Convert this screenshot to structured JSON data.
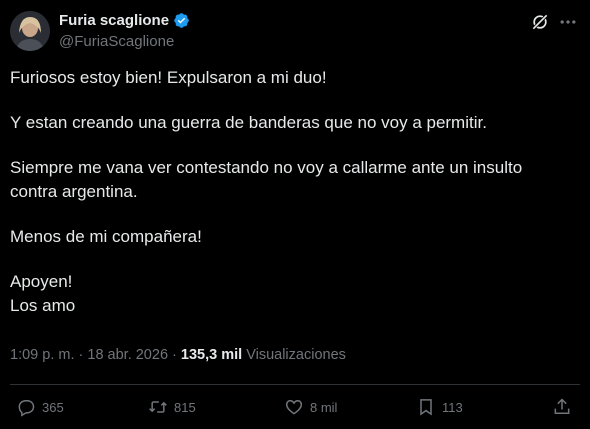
{
  "author": {
    "name": "Furia scaglione",
    "handle": "@FuriaScaglione",
    "verified": true
  },
  "tweet": {
    "lines": [
      "Furiosos estoy bien! Expulsaron a mi duo!",
      "Y estan creando una guerra de banderas que no voy a permitir.",
      "Siempre me vana ver contestando no voy a callarme ante un insulto contra argentina.",
      "Menos de mi compañera!",
      "Apoyen!",
      "Los amo"
    ]
  },
  "meta": {
    "time": "1:09 p. m.",
    "date": "18 abr. 2026",
    "views_count": "135,3 mil",
    "views_label": "Visualizaciones"
  },
  "actions": {
    "replies": "365",
    "retweets": "815",
    "likes": "8 mil",
    "bookmarks": "113"
  },
  "colors": {
    "background": "#000000",
    "text": "#e7e9ea",
    "muted": "#71767b",
    "verified": "#1d9bf0",
    "divider": "#2f3336"
  },
  "icons": [
    "verified-badge-icon",
    "grok-icon",
    "more-icon",
    "reply-icon",
    "retweet-icon",
    "like-icon",
    "bookmark-icon",
    "share-icon"
  ]
}
